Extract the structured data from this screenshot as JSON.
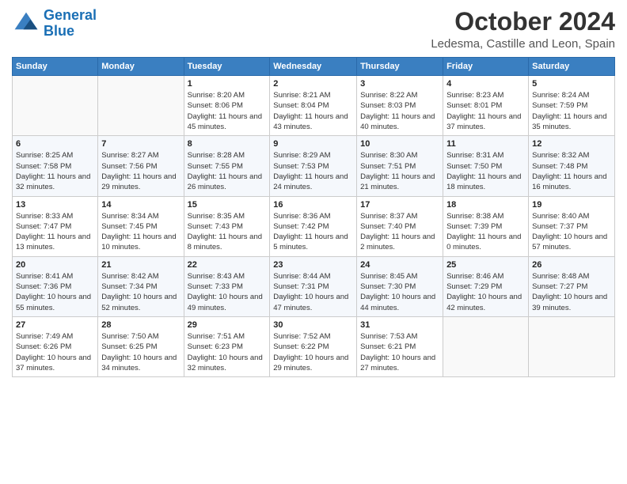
{
  "header": {
    "logo_line1": "General",
    "logo_line2": "Blue",
    "month": "October 2024",
    "location": "Ledesma, Castille and Leon, Spain"
  },
  "weekdays": [
    "Sunday",
    "Monday",
    "Tuesday",
    "Wednesday",
    "Thursday",
    "Friday",
    "Saturday"
  ],
  "weeks": [
    [
      {
        "day": "",
        "info": ""
      },
      {
        "day": "",
        "info": ""
      },
      {
        "day": "1",
        "info": "Sunrise: 8:20 AM\nSunset: 8:06 PM\nDaylight: 11 hours and 45 minutes."
      },
      {
        "day": "2",
        "info": "Sunrise: 8:21 AM\nSunset: 8:04 PM\nDaylight: 11 hours and 43 minutes."
      },
      {
        "day": "3",
        "info": "Sunrise: 8:22 AM\nSunset: 8:03 PM\nDaylight: 11 hours and 40 minutes."
      },
      {
        "day": "4",
        "info": "Sunrise: 8:23 AM\nSunset: 8:01 PM\nDaylight: 11 hours and 37 minutes."
      },
      {
        "day": "5",
        "info": "Sunrise: 8:24 AM\nSunset: 7:59 PM\nDaylight: 11 hours and 35 minutes."
      }
    ],
    [
      {
        "day": "6",
        "info": "Sunrise: 8:25 AM\nSunset: 7:58 PM\nDaylight: 11 hours and 32 minutes."
      },
      {
        "day": "7",
        "info": "Sunrise: 8:27 AM\nSunset: 7:56 PM\nDaylight: 11 hours and 29 minutes."
      },
      {
        "day": "8",
        "info": "Sunrise: 8:28 AM\nSunset: 7:55 PM\nDaylight: 11 hours and 26 minutes."
      },
      {
        "day": "9",
        "info": "Sunrise: 8:29 AM\nSunset: 7:53 PM\nDaylight: 11 hours and 24 minutes."
      },
      {
        "day": "10",
        "info": "Sunrise: 8:30 AM\nSunset: 7:51 PM\nDaylight: 11 hours and 21 minutes."
      },
      {
        "day": "11",
        "info": "Sunrise: 8:31 AM\nSunset: 7:50 PM\nDaylight: 11 hours and 18 minutes."
      },
      {
        "day": "12",
        "info": "Sunrise: 8:32 AM\nSunset: 7:48 PM\nDaylight: 11 hours and 16 minutes."
      }
    ],
    [
      {
        "day": "13",
        "info": "Sunrise: 8:33 AM\nSunset: 7:47 PM\nDaylight: 11 hours and 13 minutes."
      },
      {
        "day": "14",
        "info": "Sunrise: 8:34 AM\nSunset: 7:45 PM\nDaylight: 11 hours and 10 minutes."
      },
      {
        "day": "15",
        "info": "Sunrise: 8:35 AM\nSunset: 7:43 PM\nDaylight: 11 hours and 8 minutes."
      },
      {
        "day": "16",
        "info": "Sunrise: 8:36 AM\nSunset: 7:42 PM\nDaylight: 11 hours and 5 minutes."
      },
      {
        "day": "17",
        "info": "Sunrise: 8:37 AM\nSunset: 7:40 PM\nDaylight: 11 hours and 2 minutes."
      },
      {
        "day": "18",
        "info": "Sunrise: 8:38 AM\nSunset: 7:39 PM\nDaylight: 11 hours and 0 minutes."
      },
      {
        "day": "19",
        "info": "Sunrise: 8:40 AM\nSunset: 7:37 PM\nDaylight: 10 hours and 57 minutes."
      }
    ],
    [
      {
        "day": "20",
        "info": "Sunrise: 8:41 AM\nSunset: 7:36 PM\nDaylight: 10 hours and 55 minutes."
      },
      {
        "day": "21",
        "info": "Sunrise: 8:42 AM\nSunset: 7:34 PM\nDaylight: 10 hours and 52 minutes."
      },
      {
        "day": "22",
        "info": "Sunrise: 8:43 AM\nSunset: 7:33 PM\nDaylight: 10 hours and 49 minutes."
      },
      {
        "day": "23",
        "info": "Sunrise: 8:44 AM\nSunset: 7:31 PM\nDaylight: 10 hours and 47 minutes."
      },
      {
        "day": "24",
        "info": "Sunrise: 8:45 AM\nSunset: 7:30 PM\nDaylight: 10 hours and 44 minutes."
      },
      {
        "day": "25",
        "info": "Sunrise: 8:46 AM\nSunset: 7:29 PM\nDaylight: 10 hours and 42 minutes."
      },
      {
        "day": "26",
        "info": "Sunrise: 8:48 AM\nSunset: 7:27 PM\nDaylight: 10 hours and 39 minutes."
      }
    ],
    [
      {
        "day": "27",
        "info": "Sunrise: 7:49 AM\nSunset: 6:26 PM\nDaylight: 10 hours and 37 minutes."
      },
      {
        "day": "28",
        "info": "Sunrise: 7:50 AM\nSunset: 6:25 PM\nDaylight: 10 hours and 34 minutes."
      },
      {
        "day": "29",
        "info": "Sunrise: 7:51 AM\nSunset: 6:23 PM\nDaylight: 10 hours and 32 minutes."
      },
      {
        "day": "30",
        "info": "Sunrise: 7:52 AM\nSunset: 6:22 PM\nDaylight: 10 hours and 29 minutes."
      },
      {
        "day": "31",
        "info": "Sunrise: 7:53 AM\nSunset: 6:21 PM\nDaylight: 10 hours and 27 minutes."
      },
      {
        "day": "",
        "info": ""
      },
      {
        "day": "",
        "info": ""
      }
    ]
  ]
}
